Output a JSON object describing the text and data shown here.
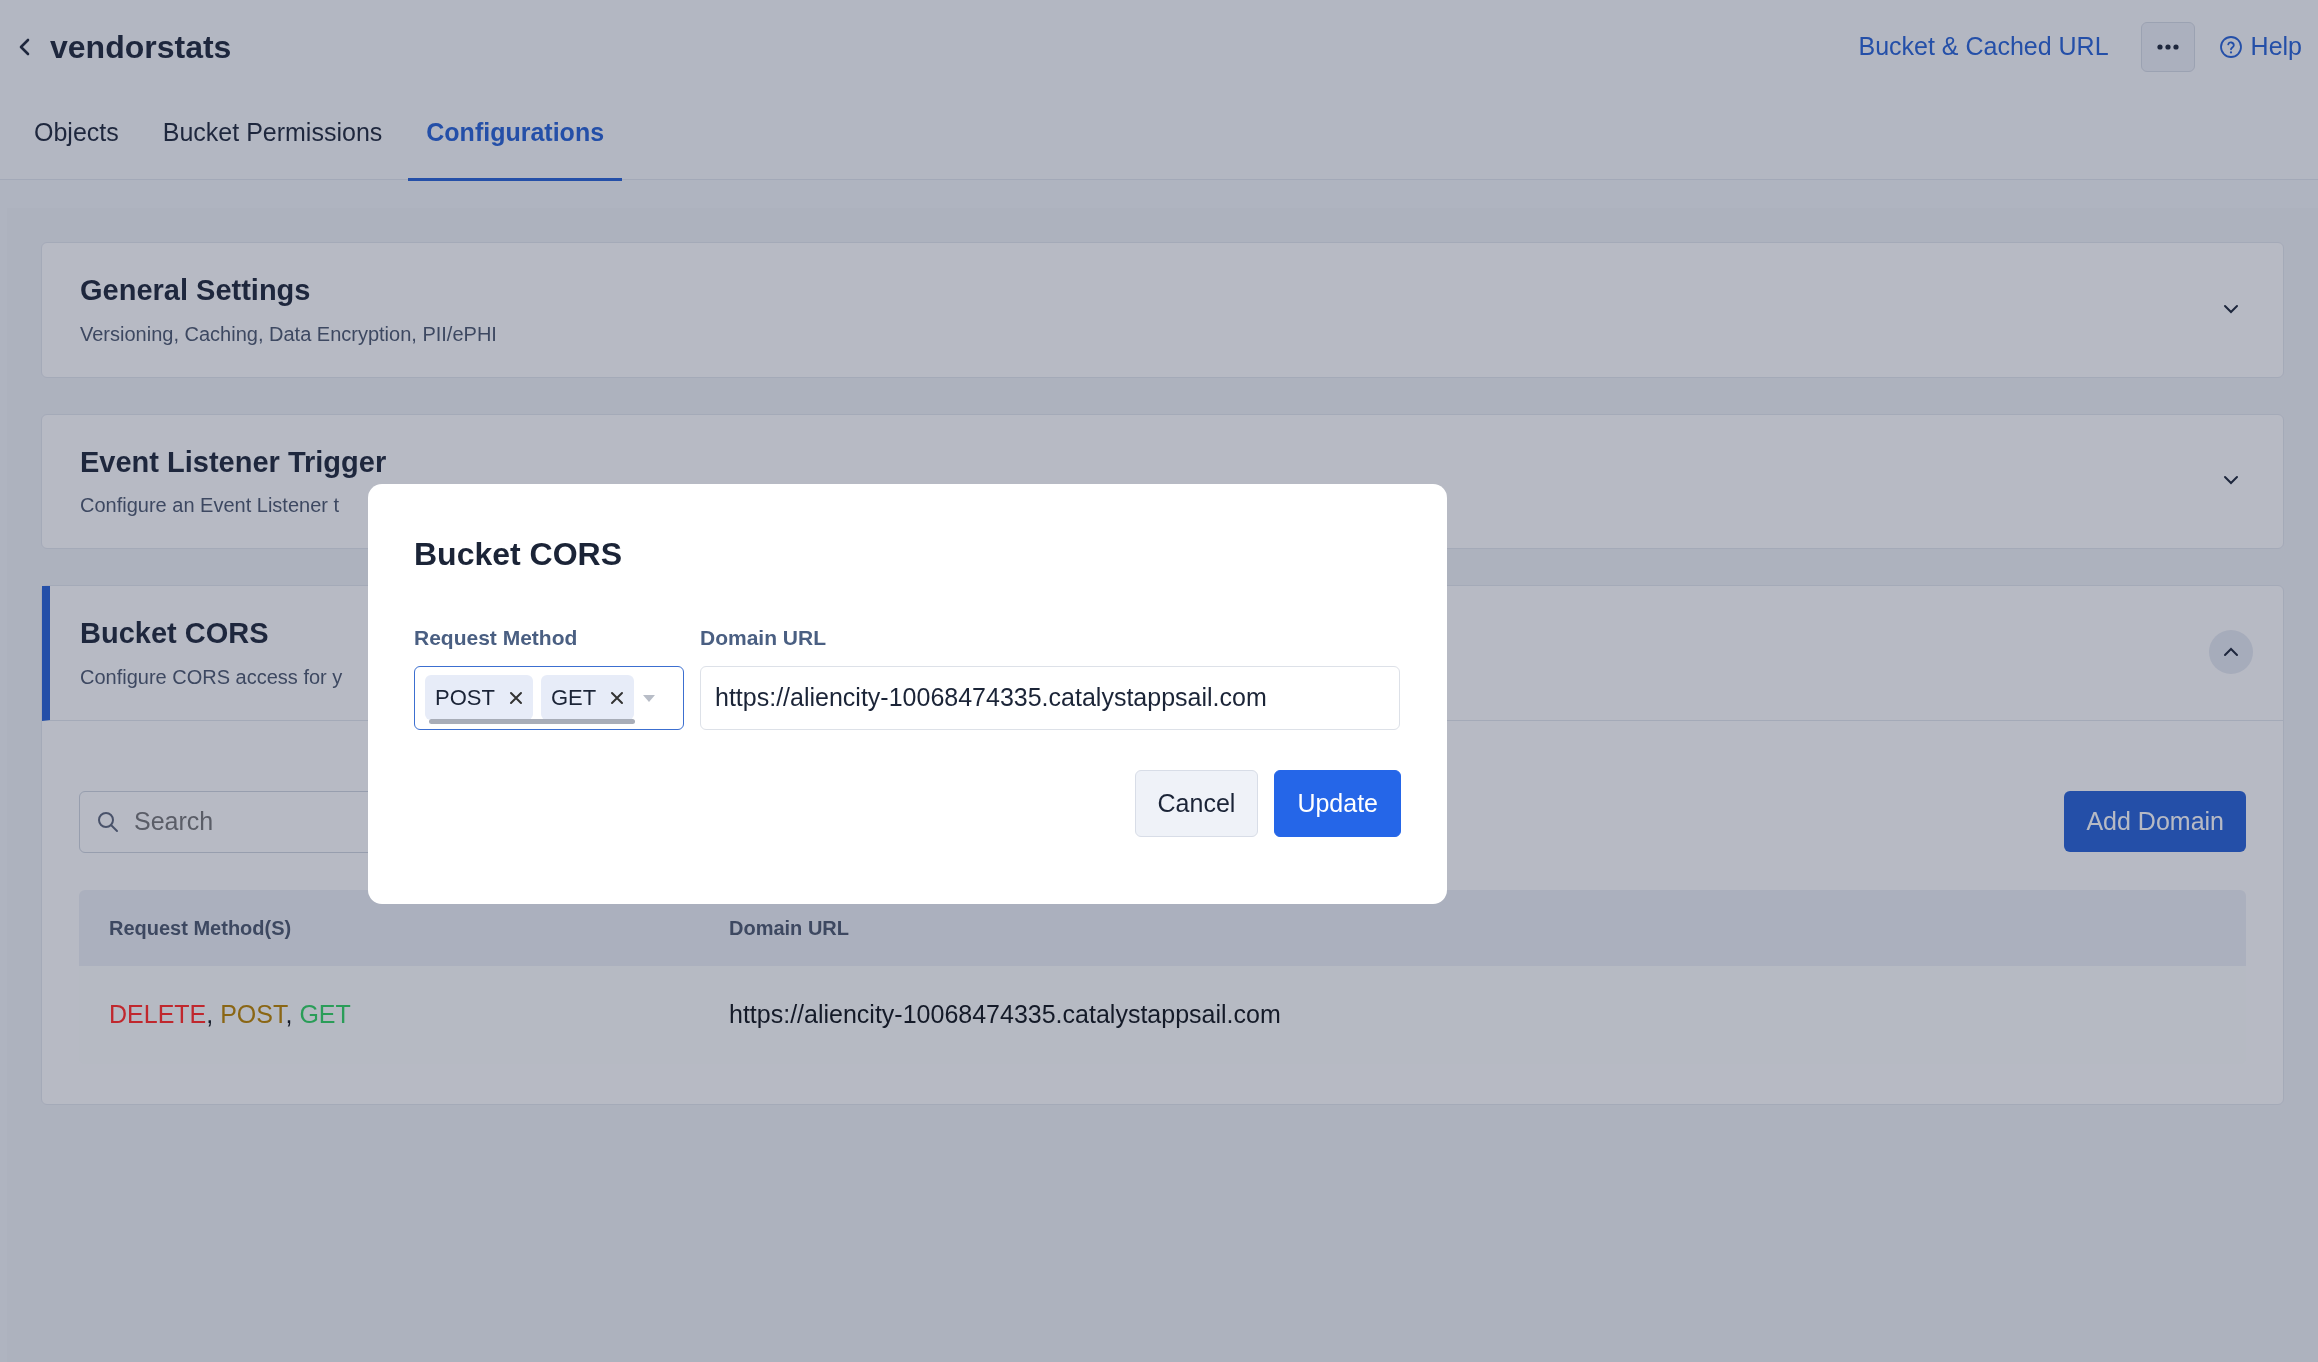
{
  "header": {
    "title": "vendorstats",
    "link": "Bucket & Cached URL",
    "help": "Help"
  },
  "tabs": [
    {
      "label": "Objects",
      "selected": false
    },
    {
      "label": "Bucket Permissions",
      "selected": false
    },
    {
      "label": "Configurations",
      "selected": true
    }
  ],
  "sections": [
    {
      "title": "General Settings",
      "description": "Versioning, Caching, Data Encryption, PII/ePHI",
      "expanded": false
    },
    {
      "title": "Event Listener Trigger",
      "description": "Configure an Event Listener t",
      "expanded": false
    },
    {
      "title": "Bucket CORS",
      "description": "Configure CORS access for y",
      "expanded": true
    }
  ],
  "cors": {
    "search": {
      "placeholder": "Search"
    },
    "add_button": "Add Domain",
    "table": {
      "columns": [
        "Request Method(S)",
        "Domain URL"
      ],
      "separator": ",",
      "rows": [
        {
          "methods": [
            {
              "label": "DELETE",
              "color": "#c0272d"
            },
            {
              "label": "POST",
              "color": "#8a6614"
            },
            {
              "label": "GET",
              "color": "#2a9d58"
            }
          ],
          "domain": "https://aliencity-10068474335.catalystappsail.com"
        }
      ]
    }
  },
  "modal": {
    "title": "Bucket CORS",
    "method_label": "Request Method",
    "methods": [
      "POST",
      "GET"
    ],
    "domain_label": "Domain URL",
    "domain_value": "https://aliencity-10068474335.catalystappsail.com",
    "buttons": [
      {
        "label": "Cancel",
        "kind": "secondary"
      },
      {
        "label": "Update",
        "kind": "primary"
      }
    ]
  }
}
